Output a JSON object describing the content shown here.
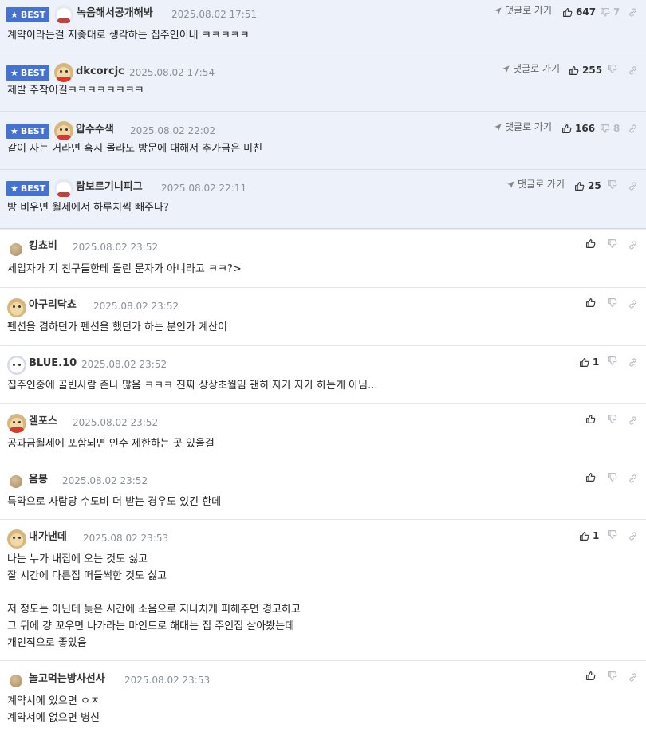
{
  "labels": {
    "best": "BEST",
    "reply": "댓글로 가기"
  },
  "colors": {
    "best_badge": "#4572cf",
    "best_row": "#edf1f9"
  },
  "comments": [
    {
      "best": true,
      "avatar": "polar-bear",
      "nick": "녹음해서공개해봐",
      "date": "2025.08.02 17:51",
      "up": "647",
      "down": "7",
      "text": "계약이라는걸 지좆대로 생각하는 집주인이네 ㅋㅋㅋㅋㅋ"
    },
    {
      "best": true,
      "avatar": "puppy-red",
      "nick": "dkcorcjc",
      "date": "2025.08.02 17:54",
      "up": "255",
      "down": "",
      "text": "제발 주작이길ㅋㅋㅋㅋㅋㅋㅋㅋ"
    },
    {
      "best": true,
      "avatar": "puppy-red",
      "nick": "압수수색",
      "date": "2025.08.02 22:02",
      "up": "166",
      "down": "8",
      "text": "같이 사는 거라면 혹시 몰라도 방문에 대해서 추가금은 미친"
    },
    {
      "best": true,
      "avatar": "polar-bear",
      "nick": "람보르기니피그",
      "date": "2025.08.02 22:11",
      "up": "25",
      "down": "",
      "text": "방 비우면 월세에서 하루치씩 빼주나?"
    },
    {
      "best": false,
      "avatar": "ball",
      "nick": "킹쵸비",
      "date": "2025.08.02 23:52",
      "up": "",
      "down": "",
      "text": "세입자가 지 친구들한테 돌린 문자가 아니라고 ㅋㅋ?>"
    },
    {
      "best": false,
      "avatar": "puppy",
      "nick": "아구리닥쵸",
      "date": "2025.08.02 23:52",
      "up": "",
      "down": "",
      "text": "펜션을 겸하던가 펜션을 했던가 하는 분인가 계산이"
    },
    {
      "best": false,
      "avatar": "white-dog",
      "nick": "BLUE.10",
      "date": "2025.08.02 23:52",
      "up": "1",
      "down": "",
      "text": "집주인중에 골빈사람 존나 많음 ㅋㅋㅋ 진짜 상상초월임 괜히 자가 자가 하는게 아님..."
    },
    {
      "best": false,
      "avatar": "puppy-red",
      "nick": "겔포스",
      "date": "2025.08.02 23:52",
      "up": "",
      "down": "",
      "text": "공과금월세에 포함되면 인수 제한하는 곳 있을걸"
    },
    {
      "best": false,
      "avatar": "ball",
      "nick": "음봉",
      "date": "2025.08.02 23:52",
      "up": "",
      "down": "",
      "text": "특약으로 사람당 수도비 더 받는 경우도 있긴 한데"
    },
    {
      "best": false,
      "avatar": "puppy",
      "nick": "내가낸데",
      "date": "2025.08.02 23:53",
      "up": "1",
      "down": "",
      "text": "나는 누가 내집에 오는 것도 싫고\n잘 시간에 다른집 떠들썩한 것도 싫고\n\n저 정도는 아닌데 늦은 시간에 소음으로 지나치게 피해주면 경고하고\n그 뒤에 걍 꼬우면 나가라는 마인드로 해대는 집 주인집 살아봤는데\n개인적으로 좋았음"
    },
    {
      "best": false,
      "avatar": "ball",
      "nick": "놀고먹는방사선사",
      "date": "2025.08.02 23:53",
      "up": "",
      "down": "",
      "text": "계약서에 있으면 ㅇㅈ\n계약서에 없으면 병신"
    }
  ]
}
